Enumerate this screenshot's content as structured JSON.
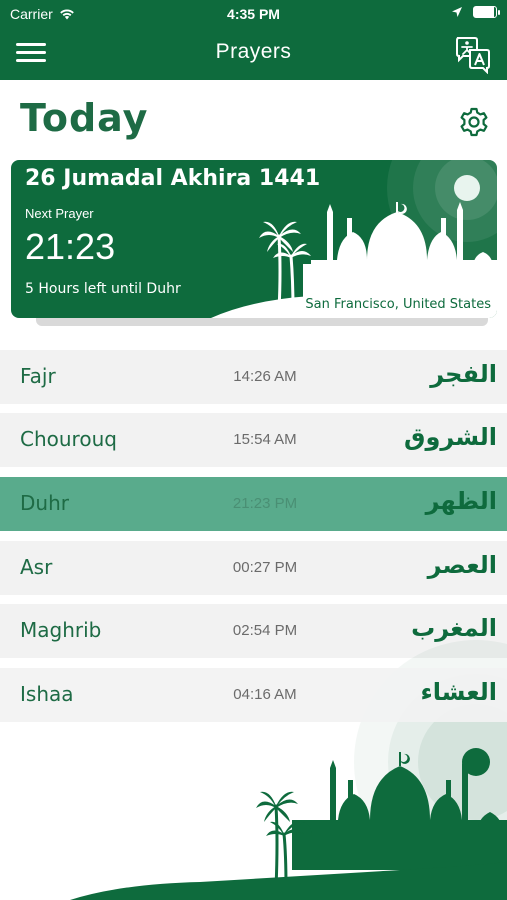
{
  "status_bar": {
    "carrier": "Carrier",
    "time": "4:35 PM",
    "battery_level": 0.92
  },
  "navbar": {
    "title": "Prayers",
    "menu_icon": "hamburger-menu-icon",
    "translate_icon": "translate-icon"
  },
  "page": {
    "heading": "Today",
    "settings_icon": "gear-icon"
  },
  "card": {
    "hijri_date": "26 Jumadal Akhira 1441",
    "next_prayer_label": "Next Prayer",
    "next_prayer_time": "21:23",
    "time_left": "5 Hours left until Duhr",
    "location": "San Francisco, United States"
  },
  "prayers": [
    {
      "name": "Fajr",
      "time": "14:26 AM",
      "arabic": "الفجر",
      "active": false
    },
    {
      "name": "Chourouq",
      "time": "15:54 AM",
      "arabic": "الشروق",
      "active": false
    },
    {
      "name": "Duhr",
      "time": "21:23 PM",
      "arabic": "الظهر",
      "active": true
    },
    {
      "name": "Asr",
      "time": "00:27 PM",
      "arabic": "العصر",
      "active": false
    },
    {
      "name": "Maghrib",
      "time": "02:54 PM",
      "arabic": "المغرب",
      "active": false
    },
    {
      "name": "Ishaa",
      "time": "04:16 AM",
      "arabic": "العشاء",
      "active": false
    }
  ],
  "colors": {
    "primary": "#0e6b3d",
    "active_row": "#59ab8c",
    "row_bg": "#f2f2f2",
    "text_green": "#1e6b45",
    "time_gray": "#6b6b6b"
  }
}
